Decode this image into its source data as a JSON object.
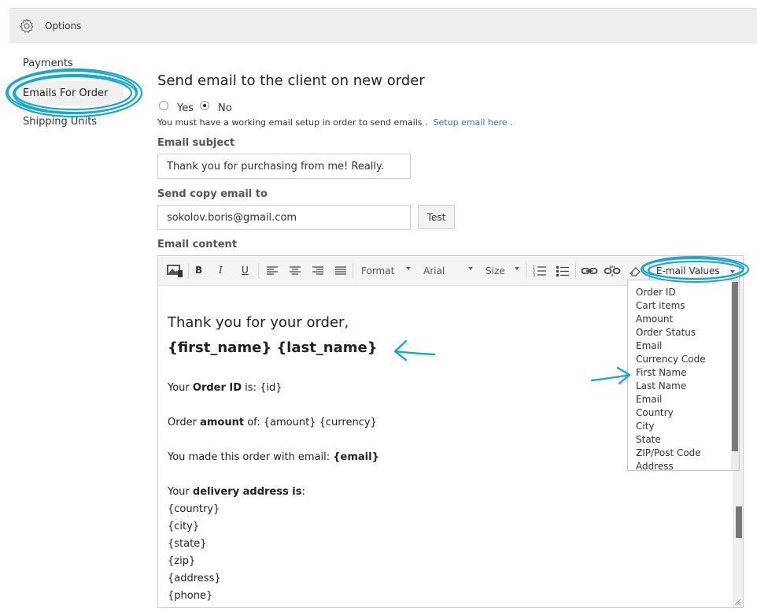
{
  "header": {
    "title": "Options"
  },
  "sidebar": {
    "items": [
      {
        "label": "Payments"
      },
      {
        "label": "Emails For Order"
      },
      {
        "label": "Shipping Units"
      }
    ]
  },
  "main": {
    "heading": "Send email to the client on new order",
    "radio_yes": "Yes",
    "radio_no": "No",
    "selected": "No",
    "note": "You must have a working email setup in order to send emails .",
    "note_link": "Setup email here",
    "note_end": ".",
    "subject_label": "Email subject",
    "subject_value": "Thank you for purchasing from me! Really.",
    "copy_label": "Send copy email to",
    "copy_value": "sokolov.boris@gmail.com",
    "test_button": "Test",
    "content_label": "Email content"
  },
  "toolbar": {
    "format": "Format",
    "font": "Arial",
    "size": "Size",
    "email_values": "E-mail Values",
    "icons": [
      "image-icon",
      "bold-icon",
      "italic-icon",
      "underline-icon",
      "align-left-icon",
      "align-center-icon",
      "align-right-icon",
      "justify-icon",
      "ordered-list-icon",
      "unordered-list-icon",
      "link-icon",
      "unlink-icon",
      "eraser-icon"
    ]
  },
  "editor_content": {
    "line1": "Thank you for your order,",
    "line2": "{first_name} {last_name}",
    "order_id_pre": "Your ",
    "order_id_bold": "Order ID",
    "order_id_post": " is: {id}",
    "amount_pre": "Order ",
    "amount_bold": "amount",
    "amount_post": " of: {amount} {currency}",
    "email_pre": "You made this order with email: ",
    "email_bold": "{email}",
    "delivery_pre": "Your ",
    "delivery_bold": "delivery address is",
    "delivery_post": ":",
    "fields": [
      "{country}",
      "{city}",
      "{state}",
      "{zip}",
      "{address}",
      "{phone}"
    ]
  },
  "dropdown": {
    "items": [
      "Order ID",
      "Cart items",
      "Amount",
      "Order Status",
      "Email",
      "Currency Code",
      "First Name",
      "Last Name",
      "Email",
      "Country",
      "City",
      "State",
      "ZIP/Post Code",
      "Address"
    ]
  },
  "colors": {
    "annotation": "#1aa6c9",
    "link": "#2a7ab5"
  }
}
